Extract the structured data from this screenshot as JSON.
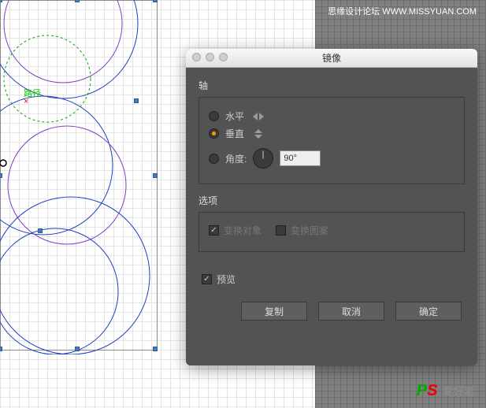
{
  "watermark": {
    "top": "思缘设计论坛  WWW.MISSYUAN.COM",
    "logo_prefix": "PS",
    "logo_text": "爱好者"
  },
  "path_label": "路径",
  "dialog": {
    "title": "镜像",
    "axis": {
      "label": "轴",
      "horizontal": "水平",
      "vertical": "垂直",
      "angle_label": "角度:",
      "angle_value": "90°",
      "selected": "vertical"
    },
    "options": {
      "label": "选项",
      "transform_objects": "变换对象",
      "transform_patterns": "变换图案"
    },
    "preview": "预览",
    "buttons": {
      "copy": "复制",
      "cancel": "取消",
      "ok": "确定"
    }
  }
}
